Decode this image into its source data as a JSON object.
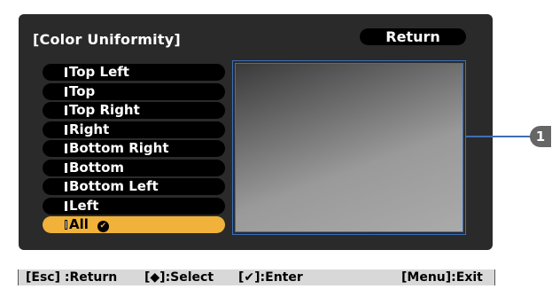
{
  "panel": {
    "title": "[Color Uniformity]",
    "return_label": "Return"
  },
  "menu": {
    "items": [
      {
        "label": "Top Left"
      },
      {
        "label": "Top"
      },
      {
        "label": "Top Right"
      },
      {
        "label": "Right"
      },
      {
        "label": "Bottom Right"
      },
      {
        "label": "Bottom"
      },
      {
        "label": "Bottom Left"
      },
      {
        "label": "Left"
      },
      {
        "label": "All",
        "selected": true
      }
    ],
    "enter_icon": "enter-icon"
  },
  "callout": {
    "number": "1"
  },
  "helpbar": {
    "esc": "[Esc] :Return",
    "select": "[◆]:Select",
    "enter": "[✔]:Enter",
    "menu": "[Menu]:Exit"
  },
  "colors": {
    "panel_bg": "#2a2a2a",
    "selected_bg": "#f0b23a",
    "frame_border": "#3d6fb5",
    "helpbar_bg": "#d8d8d8"
  }
}
